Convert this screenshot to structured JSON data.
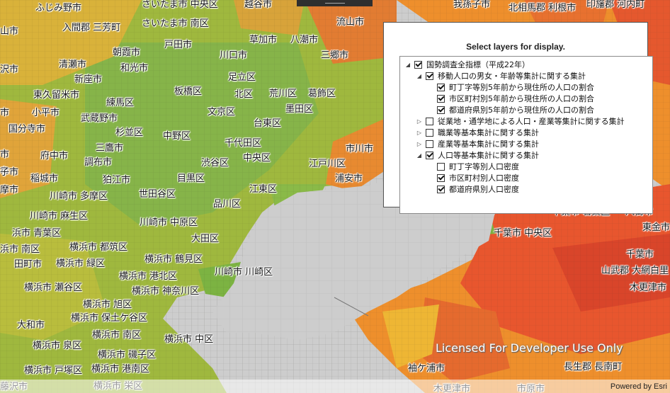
{
  "map": {
    "cities": [
      "ふじみ野市",
      "さいたま市 中央区",
      "越谷市",
      "我孫子市",
      "北相馬郡 利根市",
      "印旛郡 河内町",
      "山市",
      "入間郡 三芳町",
      "さいたま市 南区",
      "草加市",
      "八潮市",
      "流山市",
      "戸田市",
      "朝霞市",
      "川口市",
      "三郷市",
      "清瀬市",
      "和光市",
      "沢市",
      "新座市",
      "足立区",
      "東久留米市",
      "練馬区",
      "板橋区",
      "北区",
      "荒川区",
      "葛飾区",
      "市",
      "小平市",
      "武蔵野市",
      "文京区",
      "墨田区",
      "国分寺市",
      "杉並区",
      "中野区",
      "台東区",
      "市",
      "千代田区",
      "市",
      "府中市",
      "三鷹市",
      "中央区",
      "市川市",
      "子市",
      "調布市",
      "渋谷区",
      "江戸川区",
      "稲城市",
      "狛江市",
      "目黒区",
      "浦安市",
      "摩市",
      "川崎市 多摩区",
      "世田谷区",
      "江東区",
      "品川区",
      "千葉市 若葉区",
      "八街市",
      "川崎市 麻生区",
      "浜市 青葉区",
      "川崎市 中原区",
      "千葉市 中央区",
      "東金市",
      "浜市 南区",
      "横浜市 都筑区",
      "大田区",
      "千葉市",
      "田町市",
      "横浜市 緑区",
      "横浜市 鶴見区",
      "山武郡 大網白里",
      "横浜市 港北区",
      "川崎市 川崎区",
      "横浜市 瀬谷区",
      "横浜市 神奈川区",
      "木更津市",
      "横浜市 旭区",
      "横浜市 保土ケ谷区",
      "大和市",
      "横浜市 南区",
      "横浜市 中区",
      "横浜市 泉区",
      "横浜市 磯子区",
      "横浜市 戸塚区",
      "横浜市 港南区",
      "袖ケ浦市",
      "長生郡 長南町",
      "藤沢市",
      "横浜市 栄区",
      "木更津市",
      "市原市"
    ],
    "colors": {
      "water": "#cdcdcd",
      "green": "#7cb342",
      "yellow": "#e0c23a",
      "orange": "#f0952a",
      "red": "#e8552e"
    }
  },
  "panel": {
    "title": "Select layers for display.",
    "tree": [
      {
        "label": "国勢調査全指標（平成22年）",
        "expanded": true,
        "checked": true
      },
      {
        "label": "移動人口の男女・年齢等集計に関する集計",
        "expanded": true,
        "checked": true
      },
      {
        "label": "町丁字等別5年前から現住所の人口の割合",
        "checked": true
      },
      {
        "label": "市区町村別5年前から現住所の人口の割合",
        "checked": true
      },
      {
        "label": "都道府県別5年前から現住所の人口の割合",
        "checked": true
      },
      {
        "label": "従業地・通学地による人口・産業等集計に関する集計",
        "expanded": false,
        "checked": false
      },
      {
        "label": "職業等基本集計に関する集計",
        "expanded": false,
        "checked": false
      },
      {
        "label": "産業等基本集計に関する集計",
        "expanded": false,
        "checked": false
      },
      {
        "label": "人口等基本集計に関する集計",
        "expanded": true,
        "checked": true
      },
      {
        "label": "町丁字等別人口密度",
        "checked": false
      },
      {
        "label": "市区町村別人口密度",
        "checked": true
      },
      {
        "label": "都道府県別人口密度",
        "checked": true
      }
    ]
  },
  "watermark": "Licensed For Developer Use Only",
  "powered_by": "Powered by Esri"
}
